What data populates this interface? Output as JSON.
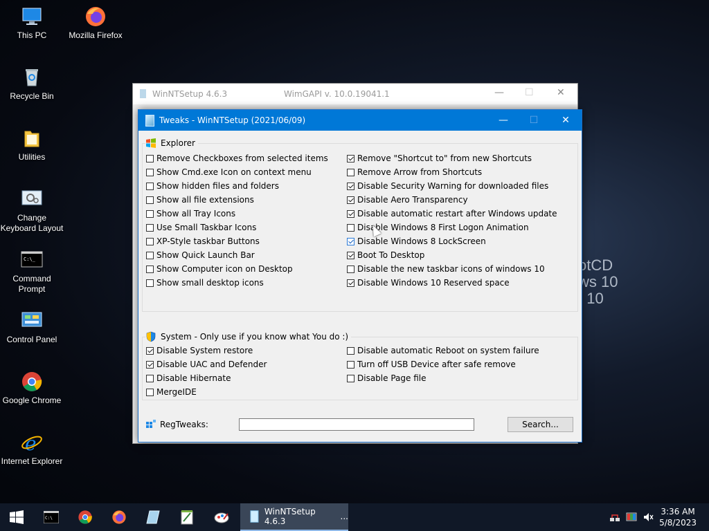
{
  "desktop": {
    "icons": [
      {
        "label": "This PC"
      },
      {
        "label": "Mozilla Firefox"
      },
      {
        "label": "Recycle Bin"
      },
      {
        "label": "Utilities"
      },
      {
        "label": "Change Keyboard Layout"
      },
      {
        "label": "Command Prompt"
      },
      {
        "label": "Control Panel"
      },
      {
        "label": "Google Chrome"
      },
      {
        "label": "Internet Explorer"
      }
    ],
    "wallpaper_text": "otCD\nws 10\n  10"
  },
  "background_window": {
    "title": "WinNTSetup 4.6.3",
    "wimgapi": "WimGAPI v. 10.0.19041.1",
    "minimize": "—",
    "maximize": "☐",
    "close": "✕"
  },
  "tweaks_window": {
    "title": "Tweaks - WinNTSetup (2021/06/09)",
    "minimize": "—",
    "maximize": "☐",
    "close": "✕",
    "explorer": {
      "title": "Explorer",
      "left": [
        {
          "label": "Remove Checkboxes from selected items",
          "checked": false
        },
        {
          "label": "Show Cmd.exe Icon on context menu",
          "checked": false
        },
        {
          "label": "Show hidden files and folders",
          "checked": false
        },
        {
          "label": "Show all file extensions",
          "checked": false
        },
        {
          "label": "Show all Tray Icons",
          "checked": false
        },
        {
          "label": "Use Small Taskbar Icons",
          "checked": false
        },
        {
          "label": "XP-Style taskbar Buttons",
          "checked": false
        },
        {
          "label": "Show Quick Launch Bar",
          "checked": false
        },
        {
          "label": "Show Computer icon on Desktop",
          "checked": false
        },
        {
          "label": "Show small desktop icons",
          "checked": false
        }
      ],
      "right": [
        {
          "label": "Remove \"Shortcut to\" from new Shortcuts",
          "checked": true
        },
        {
          "label": "Remove Arrow from Shortcuts",
          "checked": false
        },
        {
          "label": "Disable Security Warning for downloaded files",
          "checked": true
        },
        {
          "label": "Disable Aero Transparency",
          "checked": true
        },
        {
          "label": "Disable automatic restart after Windows update",
          "checked": true
        },
        {
          "label": "Disable Windows 8 First Logon Animation",
          "checked": false
        },
        {
          "label": "Disable Windows 8 LockScreen",
          "checked": true
        },
        {
          "label": "Boot To Desktop",
          "checked": true
        },
        {
          "label": "Disable the new taskbar icons of windows 10",
          "checked": false
        },
        {
          "label": "Disable Windows 10 Reserved space",
          "checked": true
        }
      ]
    },
    "system": {
      "title": "System - Only use if you know what You do :)",
      "left": [
        {
          "label": "Disable System restore",
          "checked": true
        },
        {
          "label": "Disable UAC and Defender",
          "checked": true
        },
        {
          "label": "Disable Hibernate",
          "checked": false
        },
        {
          "label": "MergeIDE",
          "checked": false
        }
      ],
      "right": [
        {
          "label": "Disable automatic Reboot on system failure",
          "checked": false
        },
        {
          "label": "Turn off USB Device after safe remove",
          "checked": false
        },
        {
          "label": "Disable Page file",
          "checked": false
        }
      ]
    },
    "regtweaks_label": "RegTweaks:",
    "regtweaks_value": "",
    "search_label": "Search..."
  },
  "taskbar": {
    "active_label": "WinNTSetup 4.6.3",
    "active_more": "...",
    "time": "3:36 AM",
    "date": "5/8/2023"
  }
}
